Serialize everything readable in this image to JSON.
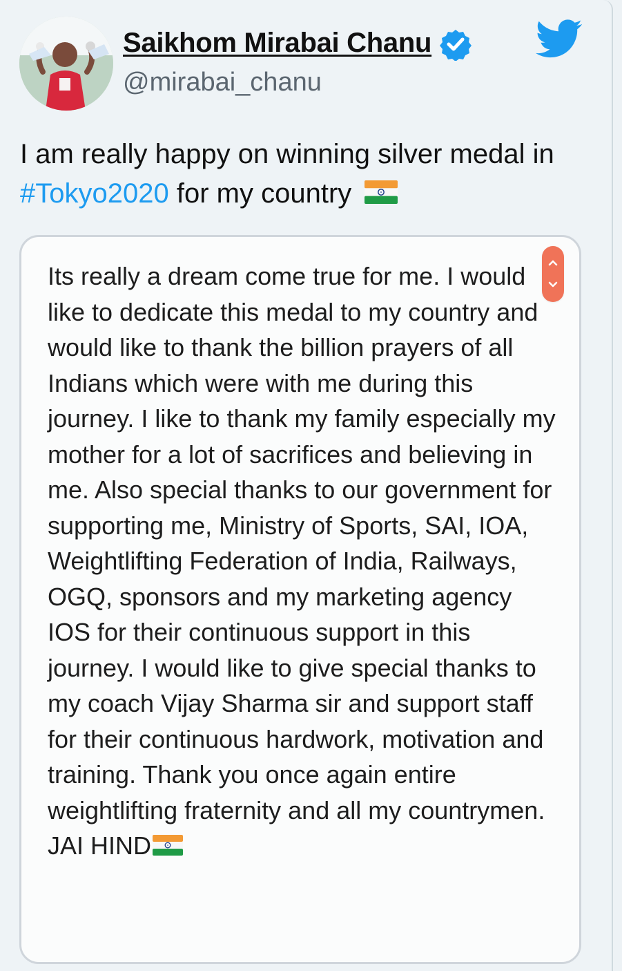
{
  "tweet": {
    "author_name": "Saikhom Mirabai Chanu",
    "handle": "@mirabai_chanu",
    "text_before": "I am really happy on winning silver medal in",
    "hashtag": "#Tokyo2020",
    "text_after": "for my country",
    "flag_icon": "india-flag-icon"
  },
  "statement": {
    "text": "Its really a dream come true for me. I would like to dedicate this medal to my country and would like to thank the billion prayers of all Indians which were with me during this journey. I like to thank my family especially my mother for a lot of sacrifices and believing in me. Also special thanks to our government for supporting me, Ministry of Sports, SAI, IOA, Weightlifting Federation of India, Railways, OGQ, sponsors and my marketing agency IOS for their continuous support in this journey. I would like to give special thanks to my coach Vijay Sharma sir and support staff for their continuous hardwork, motivation and training. Thank you once again entire weightlifting fraternity and all my countrymen. JAI HIND",
    "end_icon": "india-flag-icon"
  },
  "icons": {
    "verified": "verified-badge-icon",
    "brand": "twitter-bird-icon",
    "scroll": "scroll-handle-icon"
  },
  "colors": {
    "page_bg": "#eef3f6",
    "hashtag": "#1d9bf0",
    "verified": "#1d9bf0",
    "twitter": "#1d9bf0",
    "scroll_handle": "#f07358"
  }
}
